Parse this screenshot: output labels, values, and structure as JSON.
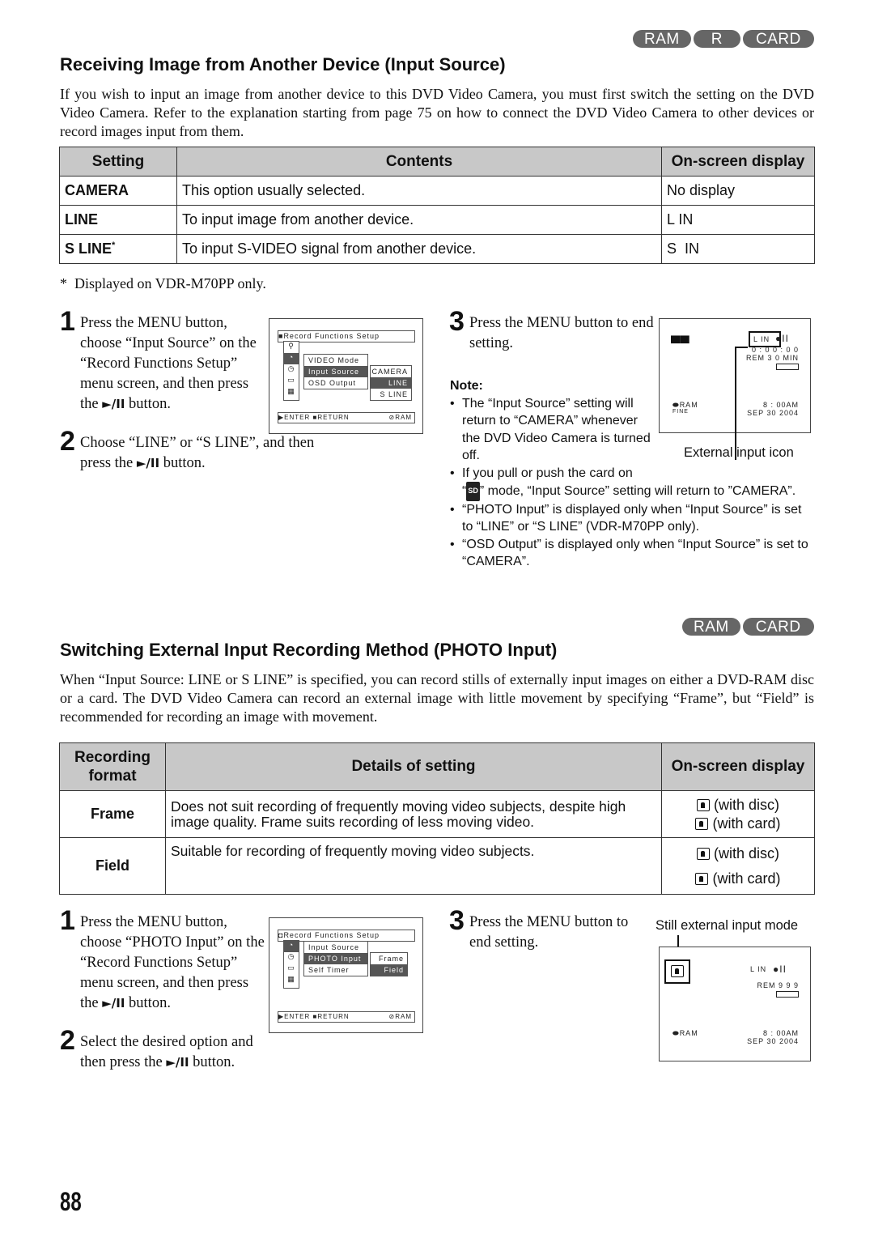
{
  "section1": {
    "badges": [
      "RAM",
      "R",
      "CARD"
    ],
    "title": "Receiving Image from Another Device (Input Source)",
    "intro": "If you wish to input an image from another device to this DVD Video Camera, you must first switch the setting on the DVD Video Camera. Refer to the explanation starting from page 75 on how to connect the DVD Video Camera to other devices or record images input from them.",
    "table": {
      "headers": [
        "Setting",
        "Contents",
        "On-screen display"
      ],
      "rows": [
        {
          "setting": "CAMERA",
          "contents": "This option usually selected.",
          "display": "No display"
        },
        {
          "setting": "LINE",
          "contents": "To input image from another device.",
          "display": "L IN"
        },
        {
          "setting": "S LINE",
          "sup": "*",
          "contents": "To input S-VIDEO signal from another device.",
          "display": "S  IN"
        }
      ]
    },
    "footnote": "*  Displayed on VDR-M70PP only.",
    "steps": [
      {
        "num": "1",
        "text": "Press the MENU button, choose “Input Source” on the “Record Functions Setup” menu screen, and then press the",
        "after": "button."
      },
      {
        "num": "2",
        "text": "Choose “LINE” or “S LINE”, and then press the",
        "after": "button."
      },
      {
        "num": "3",
        "text": "Press the MENU button to end setting."
      }
    ],
    "play_pause_glyph": "►/II",
    "menu_screen": {
      "title": "Record Functions Setup",
      "items": [
        "VIDEO Mode",
        "Input Source",
        "OSD Output"
      ],
      "options": [
        "CAMERA",
        "LINE",
        "S LINE"
      ],
      "selected_item": "Input Source",
      "selected_option": "LINE",
      "footer": {
        "enter": "ENTER",
        "return": "RETURN",
        "media": "RAM"
      }
    },
    "display_screen": {
      "input_icon": "L IN",
      "counter": "0 : 0 0 : 0 0",
      "remaining": "REM 3 0 MIN",
      "media": "RAM",
      "quality": "FINE",
      "time": "8 : 00AM",
      "date": "SEP 30 2004",
      "caption": "External input icon"
    },
    "note": {
      "title": "Note:",
      "items": [
        "The “Input Source” setting will return to “CAMERA” whenever the DVD Video Camera is turned off.",
        "If you pull or push the card on",
        "“PHOTO Input” is displayed only when “Input Source” is set to “LINE” or “S LINE” (VDR-M70PP only).",
        "“OSD Output” is displayed only when “Input Source” is set to “CAMERA”."
      ],
      "sd_label": "SD",
      "item2_open": "“",
      "item2_rest": "” mode, “Input Source” setting will return to ”CAMERA”."
    }
  },
  "section2": {
    "badges": [
      "RAM",
      "CARD"
    ],
    "title": "Switching External Input Recording Method (PHOTO Input)",
    "intro": "When “Input Source: LINE or S LINE” is specified, you can record stills of externally input images on either a DVD-RAM disc or a card.  The DVD Video Camera can record an external image with little movement by specifying “Frame”, but “Field” is recommended for recording an image with movement.",
    "table": {
      "headers": [
        "Recording format",
        "Details of setting",
        "On-screen display"
      ],
      "rows": [
        {
          "format": "Frame",
          "details": "Does not suit recording of frequently moving video subjects, despite high image quality. Frame suits recording of less moving video.",
          "display": [
            "(with disc)",
            "(with card)"
          ]
        },
        {
          "format": "Field",
          "details": "Suitable for recording of frequently moving video subjects.",
          "display": [
            "(with disc)",
            "(with card)"
          ]
        }
      ]
    },
    "steps": [
      {
        "num": "1",
        "text": "Press the MENU button, choose “PHOTO Input” on the “Record Functions Setup” menu screen, and then press the",
        "after": "button."
      },
      {
        "num": "2",
        "text": "Select the desired option and then press the",
        "after": "button."
      },
      {
        "num": "3",
        "text": "Press the MENU button to end setting."
      }
    ],
    "menu_screen": {
      "title": "Record Functions Setup",
      "items": [
        "Input Source",
        "PHOTO Input",
        "Self Timer"
      ],
      "options": [
        "Frame",
        "Field"
      ],
      "selected_item": "PHOTO Input",
      "selected_option": "Field",
      "footer": {
        "enter": "ENTER",
        "return": "RETURN",
        "media": "RAM"
      }
    },
    "display_screen": {
      "caption": "Still external input mode",
      "input_icon": "L IN",
      "remaining": "REM  9 9 9",
      "media": "RAM",
      "time": "8 : 00AM",
      "date": "SEP 30 2004"
    }
  },
  "page_number": "88"
}
